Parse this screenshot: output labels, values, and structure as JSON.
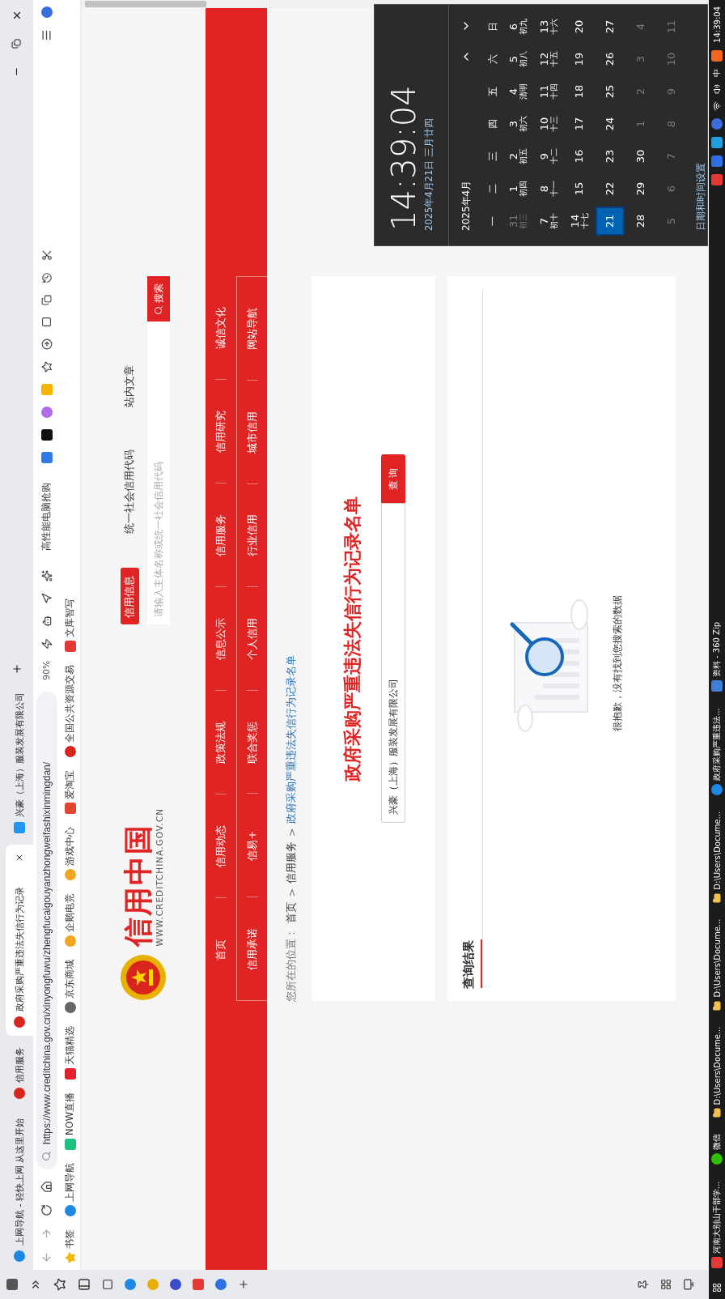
{
  "browser": {
    "tabs": [
      {
        "title": "上网导航 - 轻快上网 从这里开始",
        "selected": false,
        "kind": "nav"
      },
      {
        "title": "信用服务",
        "selected": false,
        "kind": "emblem"
      },
      {
        "title": "政府采购严重违法失信行为记录",
        "selected": true,
        "kind": "emblem"
      },
      {
        "title": "兴豪（上海）服装发展有限公司",
        "selected": false,
        "kind": "search"
      }
    ],
    "url": "https://www.creditchina.gov.cn/xinyongfuwu/zhengfucaigouyanzhongweifashixinmingdan/",
    "zoom": "90%",
    "promo": "高性能电脑抢购",
    "bookmarks": [
      {
        "label": "书签",
        "kind": "star"
      },
      {
        "label": "上网导航",
        "kind": "nav"
      },
      {
        "label": "NOW直播",
        "kind": "now"
      },
      {
        "label": "天猫精选",
        "kind": "tmall"
      },
      {
        "label": "京东商城",
        "kind": "jd"
      },
      {
        "label": "企鹅电竞",
        "kind": "game"
      },
      {
        "label": "游戏中心",
        "kind": "game"
      },
      {
        "label": "爱淘宝",
        "kind": "taobao"
      },
      {
        "label": "全国公共资源交易",
        "kind": "emblem"
      },
      {
        "label": "文库智写",
        "kind": "wenku"
      }
    ]
  },
  "site": {
    "logo": {
      "name": "信用中国",
      "domain": "WWW.CREDITCHINA.GOV.CN"
    },
    "search": {
      "tabs": [
        {
          "label": "信用信息",
          "selected": true
        },
        {
          "label": "统一社会信用代码",
          "selected": false
        },
        {
          "label": "站内文章",
          "selected": false
        }
      ],
      "placeholder": "请输入主体名称或统一社会信用代码",
      "button": "搜索"
    },
    "nav": [
      [
        "首页",
        "信用动态",
        "政策法规",
        "信息公示",
        "信用服务",
        "信用研究",
        "诚信文化"
      ],
      [
        "信用承诺",
        "信易+",
        "联合奖惩",
        "个人信用",
        "行业信用",
        "城市信用",
        "网站导航"
      ]
    ],
    "breadcrumb": {
      "prefix": "您所在的位置：",
      "items": [
        {
          "kind": "link",
          "text": "首页"
        },
        {
          "kind": "separator",
          "text": ">"
        },
        {
          "kind": "link",
          "text": "信用服务"
        },
        {
          "kind": "separator",
          "text": ">"
        },
        {
          "kind": "current",
          "text": "政府采购严重违法失信行为记录名单"
        }
      ]
    }
  },
  "query": {
    "title": "政府采购严重违法失信行为记录名单",
    "value": "兴豪（上海）服装发展有限公司",
    "button": "查 询"
  },
  "results": {
    "heading": "查询结果",
    "empty_message": "很抱歉，没有找到您搜索的数据"
  },
  "calendar": {
    "time": "14:39:04",
    "date": "2025年4月21日 三月廿四",
    "month": "2025年4月",
    "weekdays": [
      "一",
      "二",
      "三",
      "四",
      "五",
      "六",
      "日"
    ],
    "weeks": [
      [
        {
          "day": "31",
          "lunar": "初三",
          "other_month": true,
          "selected": false
        },
        {
          "day": "1",
          "lunar": "初四",
          "other_month": false,
          "selected": false
        },
        {
          "day": "2",
          "lunar": "初五",
          "other_month": false,
          "selected": false
        },
        {
          "day": "3",
          "lunar": "初六",
          "other_month": false,
          "selected": false
        },
        {
          "day": "4",
          "lunar": "清明",
          "other_month": false,
          "selected": false
        },
        {
          "day": "5",
          "lunar": "初八",
          "other_month": false,
          "selected": false
        },
        {
          "day": "6",
          "lunar": "初九",
          "other_month": false,
          "selected": false
        }
      ],
      [
        {
          "day": "7",
          "lunar": "初十",
          "other_month": false,
          "selected": false
        },
        {
          "day": "8",
          "lunar": "十一",
          "other_month": false,
          "selected": false
        },
        {
          "day": "9",
          "lunar": "十二",
          "other_month": false,
          "selected": false
        },
        {
          "day": "10",
          "lunar": "十三",
          "other_month": false,
          "selected": false
        },
        {
          "day": "11",
          "lunar": "十四",
          "other_month": false,
          "selected": false
        },
        {
          "day": "12",
          "lunar": "十五",
          "other_month": false,
          "selected": false
        },
        {
          "day": "13",
          "lunar": "十六",
          "other_month": false,
          "selected": false
        }
      ],
      [
        {
          "day": "14",
          "lunar": "十七",
          "other_month": false,
          "selected": false
        },
        {
          "day": "15",
          "other_month": false,
          "selected": false
        },
        {
          "day": "16",
          "other_month": false,
          "selected": false
        },
        {
          "day": "17",
          "other_month": false,
          "selected": false
        },
        {
          "day": "18",
          "other_month": false,
          "selected": false
        },
        {
          "day": "19",
          "other_month": false,
          "selected": false
        },
        {
          "day": "20",
          "other_month": false,
          "selected": false
        }
      ],
      [
        {
          "day": "21",
          "other_month": false,
          "selected": true
        },
        {
          "day": "22",
          "other_month": false,
          "selected": false
        },
        {
          "day": "23",
          "other_month": false,
          "selected": false
        },
        {
          "day": "24",
          "other_month": false,
          "selected": false
        },
        {
          "day": "25",
          "other_month": false,
          "selected": false
        },
        {
          "day": "26",
          "other_month": false,
          "selected": false
        },
        {
          "day": "27",
          "other_month": false,
          "selected": false
        }
      ],
      [
        {
          "day": "28",
          "other_month": false,
          "selected": false
        },
        {
          "day": "29",
          "other_month": false,
          "selected": false
        },
        {
          "day": "30",
          "other_month": false,
          "selected": false
        },
        {
          "day": "1",
          "other_month": true,
          "selected": false
        },
        {
          "day": "2",
          "other_month": true,
          "selected": false
        },
        {
          "day": "3",
          "other_month": true,
          "selected": false
        },
        {
          "day": "4",
          "other_month": true,
          "selected": false
        }
      ],
      [
        {
          "day": "5",
          "other_month": true,
          "selected": false
        },
        {
          "day": "6",
          "other_month": true,
          "selected": false
        },
        {
          "day": "7",
          "other_month": true,
          "selected": false
        },
        {
          "day": "8",
          "other_month": true,
          "selected": false
        },
        {
          "day": "9",
          "other_month": true,
          "selected": false
        },
        {
          "day": "10",
          "other_month": true,
          "selected": false
        },
        {
          "day": "11",
          "other_month": true,
          "selected": false
        }
      ]
    ],
    "settings_link": "日期和时间设置"
  },
  "taskbar": {
    "tasks": [
      {
        "label": "河南大别山干部学...",
        "kind": "wps"
      },
      {
        "label": "微信",
        "kind": "wechat"
      },
      {
        "label": "D:\\Users\\Docume...",
        "kind": "folder"
      },
      {
        "label": "D:\\Users\\Docume...",
        "kind": "folder"
      },
      {
        "label": "D:\\Users\\Docume...",
        "kind": "folder"
      },
      {
        "label": "政府采购严重违法...",
        "kind": "browser"
      },
      {
        "label": "资料 - 360 Zip",
        "kind": "zip"
      }
    ],
    "ime": "中",
    "clock": "14:39:04"
  }
}
